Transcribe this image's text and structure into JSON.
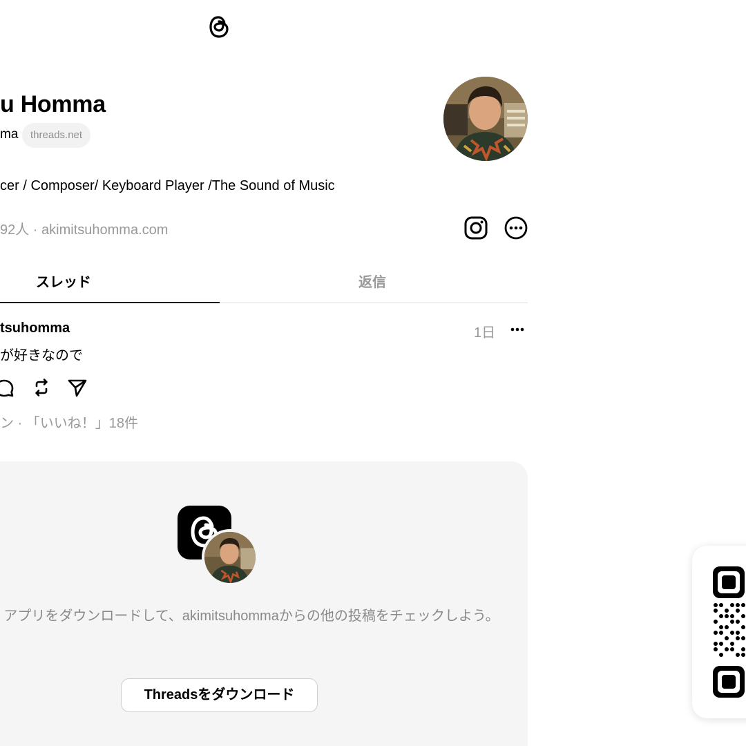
{
  "header": {
    "logo_icon": "threads-logo-icon"
  },
  "profile": {
    "display_name": "u Homma",
    "username": "ma",
    "domain_badge": "threads.net",
    "avatar_icon": "profile-photo",
    "bio": "cer / Composer/ Keyboard Player /The Sound of Music",
    "followers": "92人",
    "separator": " · ",
    "link": "akimitsuhomma.com"
  },
  "tabs": [
    {
      "label": "スレッド",
      "active": true
    },
    {
      "label": "返信",
      "active": false
    }
  ],
  "post": {
    "author": "tsuhomma",
    "time": "1日",
    "text": "が好きなので",
    "stats": "ン · 「いいね！」18件"
  },
  "cta": {
    "text": "アプリをダウンロードして、akimitsuhommaからの他の投稿をチェックしよう。",
    "button_label": "Threadsをダウンロード"
  },
  "colors": {
    "text": "#000000",
    "muted": "#999999",
    "card_bg": "#f5f5f5",
    "divider": "#dbdbdb"
  }
}
